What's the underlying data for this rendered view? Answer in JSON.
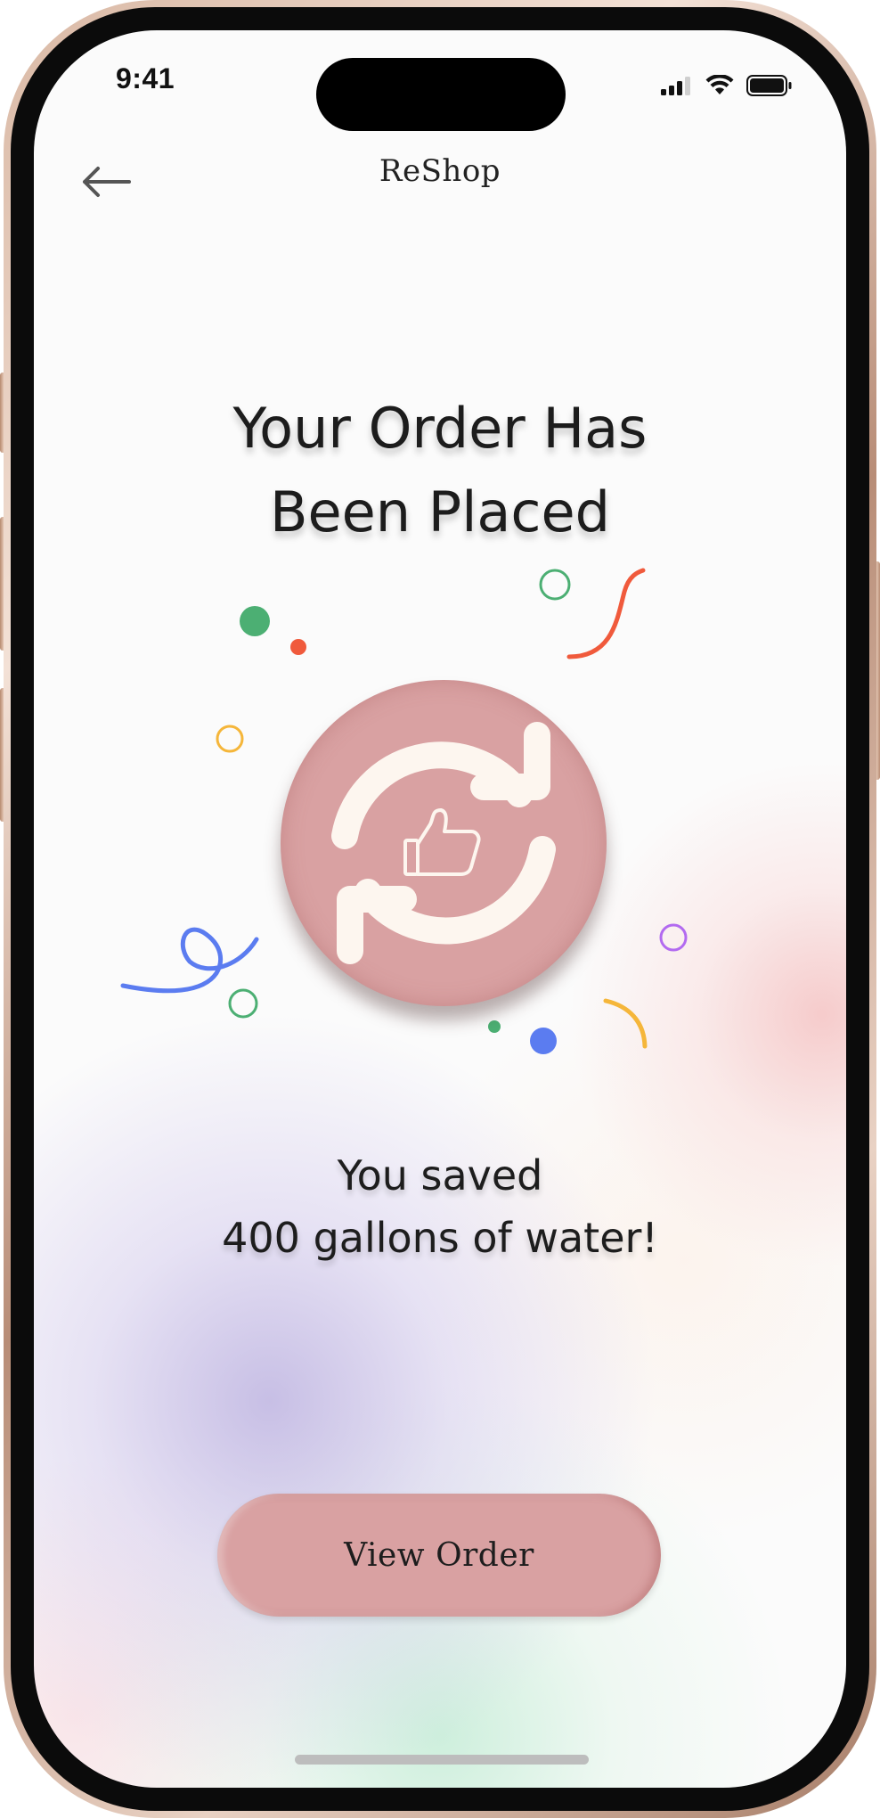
{
  "status_bar": {
    "time": "9:41",
    "icons": [
      "cellular-signal-icon",
      "wifi-icon",
      "battery-icon"
    ]
  },
  "header": {
    "back_icon": "arrow-left-icon",
    "brand": "ReShop"
  },
  "confirmation": {
    "title_line1": "Your Order Has",
    "title_line2": "Been Placed",
    "badge_icon": "recycle-thumbs-up-icon",
    "saved_line1": "You saved",
    "saved_line2": "400 gallons of water!"
  },
  "actions": {
    "view_order_label": "View Order"
  },
  "colors": {
    "accent": "#d9a1a2",
    "confetti_green": "#4caf73",
    "confetti_red": "#f05a3c",
    "confetti_yellow": "#f5b63a",
    "confetti_blue": "#5b7cf0",
    "confetti_purple": "#b26af0"
  }
}
